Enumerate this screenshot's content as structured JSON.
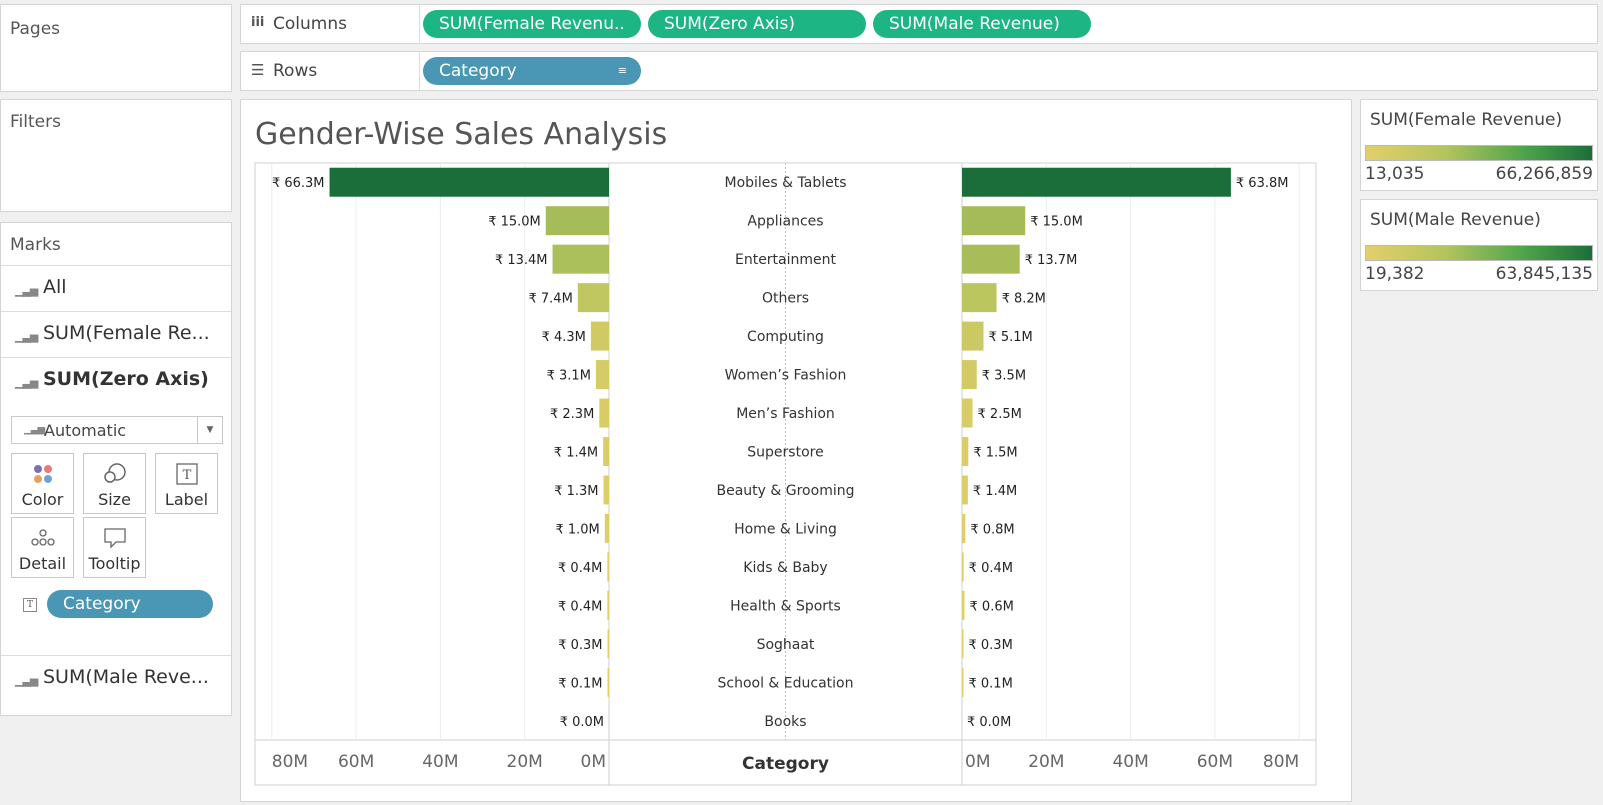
{
  "shelves": {
    "pages_title": "Pages",
    "filters_title": "Filters",
    "columns_label": "Columns",
    "rows_label": "Rows",
    "columns_pills": [
      "SUM(Female Revenu..",
      "SUM(Zero Axis)",
      "SUM(Male Revenue)"
    ],
    "rows_pill": "Category"
  },
  "marks": {
    "title": "Marks",
    "all_label": "All",
    "female_label": "SUM(Female Re...",
    "zero_label": "SUM(Zero Axis)",
    "male_label": "SUM(Male Reve...",
    "mark_type": "Automatic",
    "buttons": {
      "color": "Color",
      "size": "Size",
      "label": "Label",
      "detail": "Detail",
      "tooltip": "Tooltip"
    },
    "label_pill": "Category"
  },
  "legends": {
    "female": {
      "title": "SUM(Female Revenue)",
      "min": "13,035",
      "max": "66,266,859"
    },
    "male": {
      "title": "SUM(Male Revenue)",
      "min": "19,382",
      "max": "63,845,135"
    }
  },
  "icons": {
    "columns": "columns-icon",
    "rows": "rows-icon",
    "sort": "sort-icon",
    "mark_type": "bar-chart-icon",
    "dropdown": "chevron-down-icon",
    "color": "color-dots-icon",
    "size": "size-icon",
    "label": "text-label-icon",
    "detail": "detail-dots-icon",
    "tooltip": "tooltip-icon"
  },
  "colors": {
    "low": "#e3cf6a",
    "mid": "#b4c45d",
    "high": "#1b6e3a",
    "pill_green": "#1eb584",
    "pill_blue": "#4a96b5"
  },
  "chart_data": {
    "type": "bar",
    "title": "Gender-Wise Sales Analysis",
    "center_header": "Category",
    "categories": [
      "Mobiles & Tablets",
      "Appliances",
      "Entertainment",
      "Others",
      "Computing",
      "Women’s Fashion",
      "Men’s Fashion",
      "Superstore",
      "Beauty & Grooming",
      "Home & Living",
      "Kids & Baby",
      "Health & Sports",
      "Soghaat",
      "School & Education",
      "Books"
    ],
    "series": [
      {
        "name": "SUM(Female Revenue)",
        "values": [
          66.3,
          15.0,
          13.4,
          7.4,
          4.3,
          3.1,
          2.3,
          1.4,
          1.3,
          1.0,
          0.4,
          0.4,
          0.3,
          0.1,
          0.0
        ],
        "labels": [
          "₹ 66.3M",
          "₹ 15.0M",
          "₹ 13.4M",
          "₹ 7.4M",
          "₹ 4.3M",
          "₹ 3.1M",
          "₹ 2.3M",
          "₹ 1.4M",
          "₹ 1.3M",
          "₹ 1.0M",
          "₹ 0.4M",
          "₹ 0.4M",
          "₹ 0.3M",
          "₹ 0.1M",
          "₹ 0.0M"
        ]
      },
      {
        "name": "SUM(Male Revenue)",
        "values": [
          63.8,
          15.0,
          13.7,
          8.2,
          5.1,
          3.5,
          2.5,
          1.5,
          1.4,
          0.8,
          0.4,
          0.6,
          0.3,
          0.1,
          0.0
        ],
        "labels": [
          "₹ 63.8M",
          "₹ 15.0M",
          "₹ 13.7M",
          "₹ 8.2M",
          "₹ 5.1M",
          "₹ 3.5M",
          "₹ 2.5M",
          "₹ 1.5M",
          "₹ 1.4M",
          "₹ 0.8M",
          "₹ 0.4M",
          "₹ 0.6M",
          "₹ 0.3M",
          "₹ 0.1M",
          "₹ 0.0M"
        ]
      }
    ],
    "axis_unit": "M",
    "xlim": [
      0,
      80
    ],
    "ticks_female": [
      "80M",
      "60M",
      "40M",
      "20M",
      "0M"
    ],
    "ticks_male": [
      "0M",
      "20M",
      "40M",
      "60M",
      "80M"
    ],
    "tick_values": [
      0,
      20,
      40,
      60,
      80
    ],
    "grid": true
  }
}
